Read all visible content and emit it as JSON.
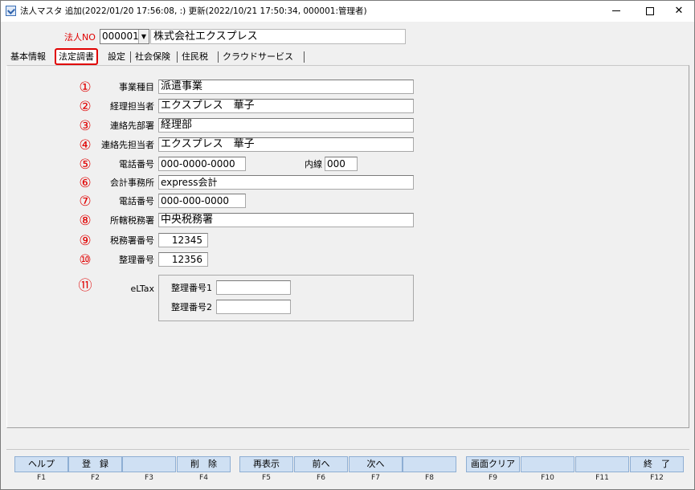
{
  "window": {
    "title": "法人マスタ  追加(2022/01/20 17:56:08, :)  更新(2022/10/21 17:50:34, 000001:管理者)",
    "minimize_glyph": "",
    "maximize_glyph": "",
    "close_glyph": "✕"
  },
  "corp": {
    "label": "法人NO",
    "number": "000001",
    "name": "株式会社エクスプレス"
  },
  "tabs": [
    "基本情報",
    "法定調書",
    "設定",
    "社会保険",
    "住民税",
    "クラウドサービス"
  ],
  "form": {
    "rows": [
      {
        "num": "①",
        "label": "事業種目",
        "value": "派遣事業"
      },
      {
        "num": "②",
        "label": "経理担当者",
        "value": "エクスプレス　華子"
      },
      {
        "num": "③",
        "label": "連絡先部署",
        "value": "経理部"
      },
      {
        "num": "④",
        "label": "連絡先担当者",
        "value": "エクスプレス　華子"
      },
      {
        "num": "⑤",
        "label": "電話番号",
        "value": "000-0000-0000",
        "ext_label": "内線",
        "ext_value": "000"
      },
      {
        "num": "⑥",
        "label": "会計事務所",
        "value": "express会計"
      },
      {
        "num": "⑦",
        "label": "電話番号",
        "value": "000-000-0000"
      },
      {
        "num": "⑧",
        "label": "所轄税務署",
        "value": "中央税務署"
      },
      {
        "num": "⑨",
        "label": "税務署番号",
        "value": "12345"
      },
      {
        "num": "⑩",
        "label": "整理番号",
        "value": "12356"
      }
    ],
    "eltax": {
      "num": "⑪",
      "label": "eLTax",
      "field1_label": "整理番号1",
      "field1_value": "",
      "field2_label": "整理番号2",
      "field2_value": ""
    }
  },
  "fkeys": [
    {
      "label": "ヘルプ",
      "key": "F1"
    },
    {
      "label": "登　録",
      "key": "F2"
    },
    {
      "label": "",
      "key": "F3"
    },
    {
      "label": "削　除",
      "key": "F4"
    },
    {
      "label": "再表示",
      "key": "F5"
    },
    {
      "label": "前へ",
      "key": "F6"
    },
    {
      "label": "次へ",
      "key": "F7"
    },
    {
      "label": "",
      "key": "F8"
    },
    {
      "label": "画面クリア",
      "key": "F9"
    },
    {
      "label": "",
      "key": "F10"
    },
    {
      "label": "",
      "key": "F11"
    },
    {
      "label": "終　了",
      "key": "F12"
    }
  ],
  "colors": {
    "accent_red": "#e00000",
    "fkey_bg": "#cfe0f3"
  }
}
